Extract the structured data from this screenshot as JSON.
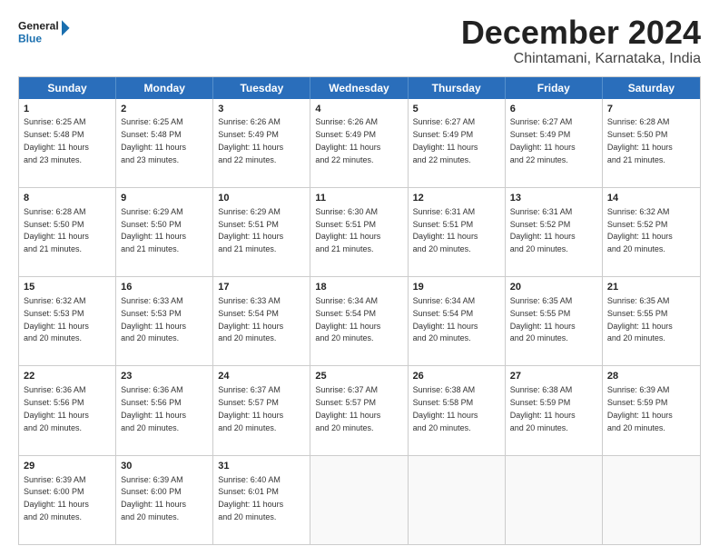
{
  "logo": {
    "line1": "General",
    "line2": "Blue"
  },
  "title": "December 2024",
  "location": "Chintamani, Karnataka, India",
  "days_of_week": [
    "Sunday",
    "Monday",
    "Tuesday",
    "Wednesday",
    "Thursday",
    "Friday",
    "Saturday"
  ],
  "weeks": [
    [
      {
        "day": 1,
        "sunrise": "6:25 AM",
        "sunset": "5:48 PM",
        "daylight": "11 hours and 23 minutes."
      },
      {
        "day": 2,
        "sunrise": "6:25 AM",
        "sunset": "5:48 PM",
        "daylight": "11 hours and 23 minutes."
      },
      {
        "day": 3,
        "sunrise": "6:26 AM",
        "sunset": "5:49 PM",
        "daylight": "11 hours and 22 minutes."
      },
      {
        "day": 4,
        "sunrise": "6:26 AM",
        "sunset": "5:49 PM",
        "daylight": "11 hours and 22 minutes."
      },
      {
        "day": 5,
        "sunrise": "6:27 AM",
        "sunset": "5:49 PM",
        "daylight": "11 hours and 22 minutes."
      },
      {
        "day": 6,
        "sunrise": "6:27 AM",
        "sunset": "5:49 PM",
        "daylight": "11 hours and 22 minutes."
      },
      {
        "day": 7,
        "sunrise": "6:28 AM",
        "sunset": "5:50 PM",
        "daylight": "11 hours and 21 minutes."
      }
    ],
    [
      {
        "day": 8,
        "sunrise": "6:28 AM",
        "sunset": "5:50 PM",
        "daylight": "11 hours and 21 minutes."
      },
      {
        "day": 9,
        "sunrise": "6:29 AM",
        "sunset": "5:50 PM",
        "daylight": "11 hours and 21 minutes."
      },
      {
        "day": 10,
        "sunrise": "6:29 AM",
        "sunset": "5:51 PM",
        "daylight": "11 hours and 21 minutes."
      },
      {
        "day": 11,
        "sunrise": "6:30 AM",
        "sunset": "5:51 PM",
        "daylight": "11 hours and 21 minutes."
      },
      {
        "day": 12,
        "sunrise": "6:31 AM",
        "sunset": "5:51 PM",
        "daylight": "11 hours and 20 minutes."
      },
      {
        "day": 13,
        "sunrise": "6:31 AM",
        "sunset": "5:52 PM",
        "daylight": "11 hours and 20 minutes."
      },
      {
        "day": 14,
        "sunrise": "6:32 AM",
        "sunset": "5:52 PM",
        "daylight": "11 hours and 20 minutes."
      }
    ],
    [
      {
        "day": 15,
        "sunrise": "6:32 AM",
        "sunset": "5:53 PM",
        "daylight": "11 hours and 20 minutes."
      },
      {
        "day": 16,
        "sunrise": "6:33 AM",
        "sunset": "5:53 PM",
        "daylight": "11 hours and 20 minutes."
      },
      {
        "day": 17,
        "sunrise": "6:33 AM",
        "sunset": "5:54 PM",
        "daylight": "11 hours and 20 minutes."
      },
      {
        "day": 18,
        "sunrise": "6:34 AM",
        "sunset": "5:54 PM",
        "daylight": "11 hours and 20 minutes."
      },
      {
        "day": 19,
        "sunrise": "6:34 AM",
        "sunset": "5:54 PM",
        "daylight": "11 hours and 20 minutes."
      },
      {
        "day": 20,
        "sunrise": "6:35 AM",
        "sunset": "5:55 PM",
        "daylight": "11 hours and 20 minutes."
      },
      {
        "day": 21,
        "sunrise": "6:35 AM",
        "sunset": "5:55 PM",
        "daylight": "11 hours and 20 minutes."
      }
    ],
    [
      {
        "day": 22,
        "sunrise": "6:36 AM",
        "sunset": "5:56 PM",
        "daylight": "11 hours and 20 minutes."
      },
      {
        "day": 23,
        "sunrise": "6:36 AM",
        "sunset": "5:56 PM",
        "daylight": "11 hours and 20 minutes."
      },
      {
        "day": 24,
        "sunrise": "6:37 AM",
        "sunset": "5:57 PM",
        "daylight": "11 hours and 20 minutes."
      },
      {
        "day": 25,
        "sunrise": "6:37 AM",
        "sunset": "5:57 PM",
        "daylight": "11 hours and 20 minutes."
      },
      {
        "day": 26,
        "sunrise": "6:38 AM",
        "sunset": "5:58 PM",
        "daylight": "11 hours and 20 minutes."
      },
      {
        "day": 27,
        "sunrise": "6:38 AM",
        "sunset": "5:59 PM",
        "daylight": "11 hours and 20 minutes."
      },
      {
        "day": 28,
        "sunrise": "6:39 AM",
        "sunset": "5:59 PM",
        "daylight": "11 hours and 20 minutes."
      }
    ],
    [
      {
        "day": 29,
        "sunrise": "6:39 AM",
        "sunset": "6:00 PM",
        "daylight": "11 hours and 20 minutes."
      },
      {
        "day": 30,
        "sunrise": "6:39 AM",
        "sunset": "6:00 PM",
        "daylight": "11 hours and 20 minutes."
      },
      {
        "day": 31,
        "sunrise": "6:40 AM",
        "sunset": "6:01 PM",
        "daylight": "11 hours and 20 minutes."
      },
      null,
      null,
      null,
      null
    ]
  ]
}
